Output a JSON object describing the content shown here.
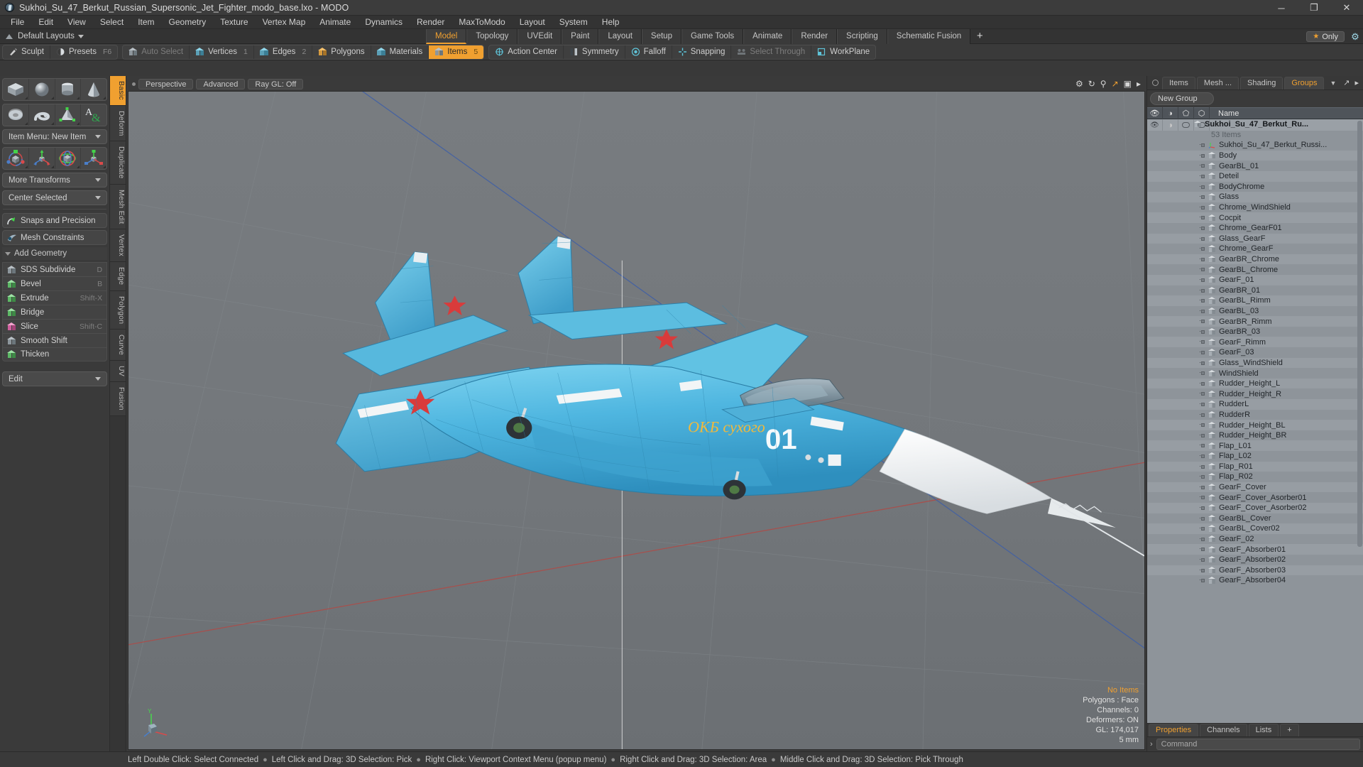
{
  "window": {
    "title": "Sukhoi_Su_47_Berkut_Russian_Supersonic_Jet_Fighter_modo_base.lxo - MODO",
    "app_icon": "modo-logo-icon",
    "minimize": "─",
    "maximize": "❐",
    "close": "✕"
  },
  "menubar": {
    "items": [
      "File",
      "Edit",
      "View",
      "Select",
      "Item",
      "Geometry",
      "Texture",
      "Vertex Map",
      "Animate",
      "Dynamics",
      "Render",
      "MaxToModo",
      "Layout",
      "System",
      "Help"
    ]
  },
  "layoutbar": {
    "layouts_label": "Default Layouts",
    "tabs": [
      {
        "label": "Model",
        "active": true
      },
      {
        "label": "Topology",
        "active": false
      },
      {
        "label": "UVEdit",
        "active": false
      },
      {
        "label": "Paint",
        "active": false
      },
      {
        "label": "Layout",
        "active": false
      },
      {
        "label": "Setup",
        "active": false
      },
      {
        "label": "Game Tools",
        "active": false
      },
      {
        "label": "Animate",
        "active": false
      },
      {
        "label": "Render",
        "active": false
      },
      {
        "label": "Scripting",
        "active": false
      },
      {
        "label": "Schematic Fusion",
        "active": false
      }
    ],
    "add_tab": "+",
    "only_label": "Only",
    "star": "★"
  },
  "modebar": {
    "group1": [
      {
        "label": "Sculpt",
        "icon": "brush-icon",
        "num": "",
        "state": "normal"
      },
      {
        "label": "Presets",
        "icon": "sphere-icon",
        "num": "F6",
        "state": "normal"
      }
    ],
    "group2": [
      {
        "label": "Auto Select",
        "icon": "cube-grey-icon",
        "num": "",
        "state": "dim"
      },
      {
        "label": "Vertices",
        "icon": "cube-blue-icon",
        "num": "1",
        "state": "normal"
      },
      {
        "label": "Edges",
        "icon": "cube-blue-icon",
        "num": "2",
        "state": "normal"
      },
      {
        "label": "Polygons",
        "icon": "cube-orange-icon",
        "num": "",
        "state": "normal"
      },
      {
        "label": "Materials",
        "icon": "cube-blue-icon",
        "num": "",
        "state": "normal"
      },
      {
        "label": "Items",
        "icon": "cube-orange-icon",
        "num": "5",
        "state": "active"
      }
    ],
    "group3": [
      {
        "label": "Action Center",
        "icon": "target-icon",
        "num": "",
        "state": "normal"
      },
      {
        "label": "Symmetry",
        "icon": "mirror-icon",
        "num": "",
        "state": "normal"
      },
      {
        "label": "Falloff",
        "icon": "concentric-icon",
        "num": "",
        "state": "normal"
      },
      {
        "label": "Snapping",
        "icon": "snap-cross-icon",
        "num": "",
        "state": "normal"
      },
      {
        "label": "Select Through",
        "icon": "select-through-icon",
        "num": "",
        "state": "dim"
      },
      {
        "label": "WorkPlane",
        "icon": "workplane-icon",
        "num": "",
        "state": "normal"
      }
    ]
  },
  "left_panel": {
    "primitive_tiles_row1": [
      "cube-primitive-icon",
      "sphere-primitive-icon",
      "cylinder-primitive-icon",
      "cone-primitive-icon"
    ],
    "primitive_tiles_row2": [
      "torus-primitive-icon",
      "spiral-primitive-icon",
      "tetrahedron-primitive-icon",
      "text-primitive-icon"
    ],
    "item_menu": "Item Menu: New Item",
    "transform_tiles": [
      "transform-all-icon",
      "move-icon",
      "rotate-icon",
      "scale-icon"
    ],
    "more_transforms": "More Transforms",
    "center_selected": "Center Selected",
    "snaps_and_precision": "Snaps and Precision",
    "mesh_constraints": "Mesh Constraints",
    "add_geometry_header": "Add Geometry",
    "geometry_tools": [
      {
        "label": "SDS Subdivide",
        "shortcut": "D",
        "icon": "sds-subdivide-icon"
      },
      {
        "label": "Bevel",
        "shortcut": "B",
        "icon": "bevel-icon"
      },
      {
        "label": "Extrude",
        "shortcut": "Shift-X",
        "icon": "extrude-icon"
      },
      {
        "label": "Bridge",
        "shortcut": "",
        "icon": "bridge-icon"
      },
      {
        "label": "Slice",
        "shortcut": "Shift-C",
        "icon": "slice-icon"
      },
      {
        "label": "Smooth Shift",
        "shortcut": "",
        "icon": "smooth-shift-icon"
      },
      {
        "label": "Thicken",
        "shortcut": "",
        "icon": "thicken-icon"
      }
    ],
    "edit_dropdown": "Edit",
    "vertical_tabs": [
      {
        "label": "Basic",
        "active": true
      },
      {
        "label": "Deform",
        "active": false
      },
      {
        "label": "Duplicate",
        "active": false
      },
      {
        "label": "Mesh Edit",
        "active": false
      },
      {
        "label": "Vertex",
        "active": false
      },
      {
        "label": "Edge",
        "active": false
      },
      {
        "label": "Polygon",
        "active": false
      },
      {
        "label": "Curve",
        "active": false
      },
      {
        "label": "UV",
        "active": false
      },
      {
        "label": "Fusion",
        "active": false
      }
    ]
  },
  "viewport": {
    "tags": [
      "Perspective",
      "Advanced",
      "Ray GL: Off"
    ],
    "corner_icons": [
      "gear-icon",
      "refresh-icon",
      "search-icon",
      "resize-icon",
      "camera-icon",
      "chevron-right-icon"
    ],
    "stats": [
      {
        "text": "No Items",
        "highlight": true
      },
      {
        "text": "Polygons : Face",
        "highlight": false
      },
      {
        "text": "Channels: 0",
        "highlight": false
      },
      {
        "text": "Deformers: ON",
        "highlight": false
      },
      {
        "text": "GL: 174,017",
        "highlight": false
      },
      {
        "text": "5 mm",
        "highlight": false
      }
    ],
    "axis_labels": {
      "y": "Y",
      "x": "X",
      "z": "Z"
    },
    "model_decal_text": "ОКБ сухого",
    "model_number": "01"
  },
  "right_panel": {
    "tabs": [
      {
        "label": "Items",
        "active": false
      },
      {
        "label": "Mesh ...",
        "active": false
      },
      {
        "label": "Shading",
        "active": false
      },
      {
        "label": "Groups",
        "active": true
      }
    ],
    "new_group_button": "New Group",
    "column_headers": {
      "visibility": "eye-icon",
      "render": "render-icon",
      "lock": "lock-icon",
      "select": "select-icon",
      "name": "Name"
    },
    "root_item": {
      "name": "Sukhoi_Su_47_Berkut_Ru...",
      "count": "53 Items"
    },
    "items": [
      "Sukhoi_Su_47_Berkut_Russi...",
      "Body",
      "GearBL_01",
      "Deteil",
      "BodyChrome",
      "Glass",
      "Chrome_WindShield",
      "Cocpit",
      "Chrome_GearF01",
      "Glass_GearF",
      "Chrome_GearF",
      "GearBR_Chrome",
      "GearBL_Chrome",
      "GearF_01",
      "GearBR_01",
      "GearBL_Rimm",
      "GearBL_03",
      "GearBR_Rimm",
      "GearBR_03",
      "GearF_Rimm",
      "GearF_03",
      "Glass_WindShield",
      "WindShield",
      "Rudder_Height_L",
      "Rudder_Height_R",
      "RudderL",
      "RudderR",
      "Rudder_Height_BL",
      "Rudder_Height_BR",
      "Flap_L01",
      "Flap_L02",
      "Flap_R01",
      "Flap_R02",
      "GearF_Cover",
      "GearF_Cover_Asorber01",
      "GearF_Cover_Asorber02",
      "GearBL_Cover",
      "GearBL_Cover02",
      "GearF_02",
      "GearF_Absorber01",
      "GearF_Absorber02",
      "GearF_Absorber03",
      "GearF_Absorber04"
    ],
    "bottom_tabs": [
      {
        "label": "Properties",
        "active": true
      },
      {
        "label": "Channels",
        "active": false
      },
      {
        "label": "Lists",
        "active": false
      },
      {
        "label": "+",
        "active": false
      }
    ],
    "command_placeholder": "Command",
    "command_chevron": "›"
  },
  "statusbar": {
    "hints": [
      "Left Double Click: Select Connected",
      "Left Click and Drag: 3D Selection: Pick",
      "Right Click: Viewport Context Menu (popup menu)",
      "Right Click and Drag: 3D Selection: Area",
      "Middle Click and Drag: 3D Selection: Pick Through"
    ],
    "bullet": "●"
  },
  "colors": {
    "accent": "#f0a030",
    "panel": "#3a3a3a",
    "list_bg": "#8e949a",
    "viewport_bg": "#75797d",
    "jet_blue": "#4bb4dd",
    "axis_x": "#c0392b",
    "axis_z": "#3b5ea8"
  }
}
